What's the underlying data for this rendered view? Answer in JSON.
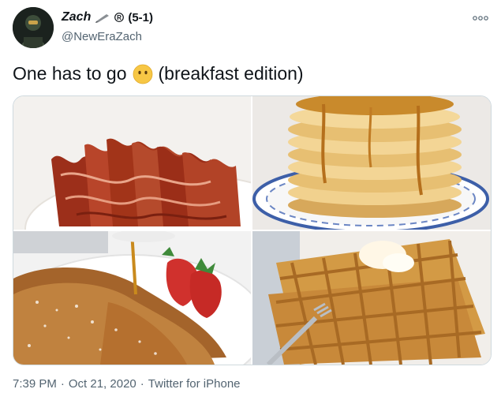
{
  "tweet": {
    "display_name": "Zach",
    "record": "(5-1)",
    "handle": "@NewEraZach",
    "text_before": "One has to go",
    "text_after": "(breakfast edition)",
    "face_emoji": "face-without-mouth-icon"
  },
  "media": {
    "images": [
      {
        "name": "bacon-photo"
      },
      {
        "name": "pancakes-photo"
      },
      {
        "name": "french-toast-photo"
      },
      {
        "name": "waffles-photo"
      }
    ]
  },
  "footer": {
    "time": "7:39 PM",
    "separator1": "·",
    "date": "Oct 21, 2020",
    "separator2": "·",
    "source": "Twitter for iPhone"
  },
  "colors": {
    "text": "#0f1419",
    "secondary": "#536471",
    "border": "#cfd9de"
  }
}
